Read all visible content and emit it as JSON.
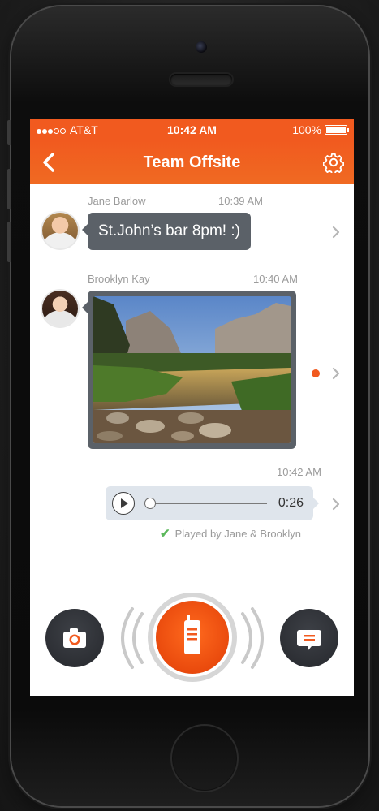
{
  "status": {
    "carrier": "AT&T",
    "time": "10:42 AM",
    "battery": "100%"
  },
  "nav": {
    "title": "Team Offsite",
    "back_icon": "chevron-left-icon",
    "settings_icon": "gear-icon"
  },
  "messages": [
    {
      "sender": "Jane Barlow",
      "time": "10:39 AM",
      "type": "text",
      "text": "St.John’s bar 8pm! :)"
    },
    {
      "sender": "Brooklyn Kay",
      "time": "10:40 AM",
      "type": "photo",
      "unread": true
    },
    {
      "sender": "",
      "time": "10:42 AM",
      "type": "audio",
      "duration": "0:26",
      "progress": 0,
      "status": "Played by Jane & Brooklyn"
    }
  ],
  "bottom_bar": {
    "camera_icon": "camera-icon",
    "ptt_icon": "walkie-talkie-icon",
    "compose_icon": "message-icon"
  },
  "colors": {
    "accent": "#f15a1f",
    "bubble": "#5b6168",
    "audio_bubble": "#dfe5ec",
    "check": "#5cb85c"
  }
}
